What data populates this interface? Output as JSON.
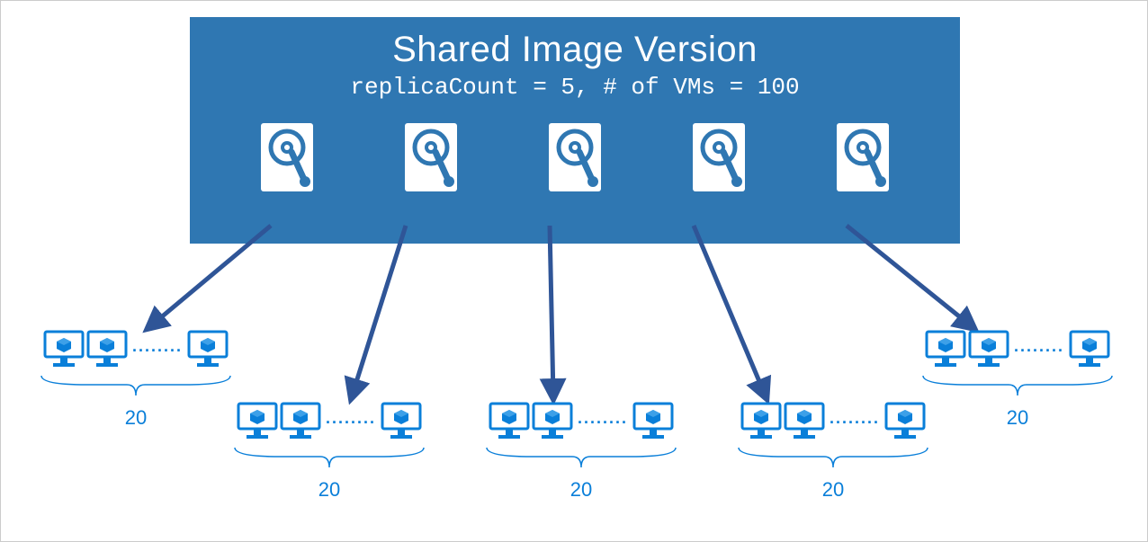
{
  "header": {
    "title": "Shared Image Version",
    "subtitle": "replicaCount = 5, # of VMs = 100"
  },
  "replica_count": 5,
  "total_vms": 100,
  "groups": [
    {
      "count_label": "20",
      "dots": "........"
    },
    {
      "count_label": "20",
      "dots": "........"
    },
    {
      "count_label": "20",
      "dots": "........"
    },
    {
      "count_label": "20",
      "dots": "........"
    },
    {
      "count_label": "20",
      "dots": "........"
    }
  ],
  "colors": {
    "header_bg": "#2F77B2",
    "azure_blue": "#0A7FD9",
    "arrow": "#2F5597"
  }
}
